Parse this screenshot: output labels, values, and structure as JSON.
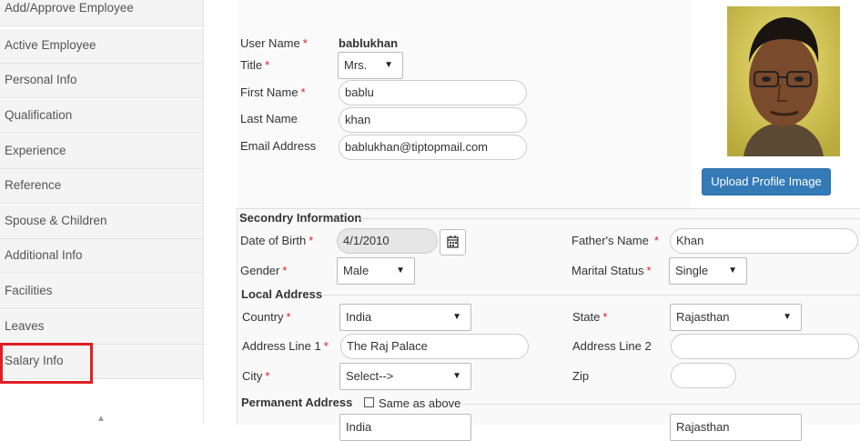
{
  "sidebar": {
    "items": [
      {
        "label": "Add/Approve Employee"
      },
      {
        "label": "Active Employee"
      },
      {
        "label": "Personal Info"
      },
      {
        "label": "Qualification"
      },
      {
        "label": "Experience"
      },
      {
        "label": "Reference"
      },
      {
        "label": "Spouse & Children"
      },
      {
        "label": "Additional Info"
      },
      {
        "label": "Facilities"
      },
      {
        "label": "Leaves"
      },
      {
        "label": "Salary Info"
      }
    ],
    "highlight_color": "#e01e25"
  },
  "profile": {
    "user_name_label": "User Name",
    "user_name_value": "bablukhan",
    "title_label": "Title",
    "title_value": "Mrs.",
    "first_name_label": "First Name",
    "first_name_value": "bablu",
    "last_name_label": "Last Name",
    "last_name_value": "khan",
    "email_label": "Email Address",
    "email_value": "bablukhan@tiptopmail.com",
    "upload_label": "Upload Profile Image",
    "required_mark": "*"
  },
  "secondary": {
    "heading": "Secondry Information",
    "dob_label": "Date of Birth",
    "dob_value": "4/1/2010",
    "father_label": "Father's Name",
    "father_value": "Khan",
    "gender_label": "Gender",
    "gender_value": "Male",
    "marital_label": "Marital Status",
    "marital_value": "Single"
  },
  "local_address": {
    "heading": "Local Address",
    "country_label": "Country",
    "country_value": "India",
    "state_label": "State",
    "state_value": "Rajasthan",
    "address1_label": "Address Line 1",
    "address1_value": "The Raj Palace",
    "address2_label": "Address Line 2",
    "address2_value": "",
    "city_label": "City",
    "city_value": "Select-->",
    "zip_label": "Zip",
    "zip_value": ""
  },
  "permanent_address": {
    "heading": "Permanent Address",
    "same_as_above_label": "Same as above",
    "country_value": "India",
    "state_value": "Rajasthan"
  },
  "colors": {
    "accent": "#337ab7",
    "required": "#e01e25"
  }
}
